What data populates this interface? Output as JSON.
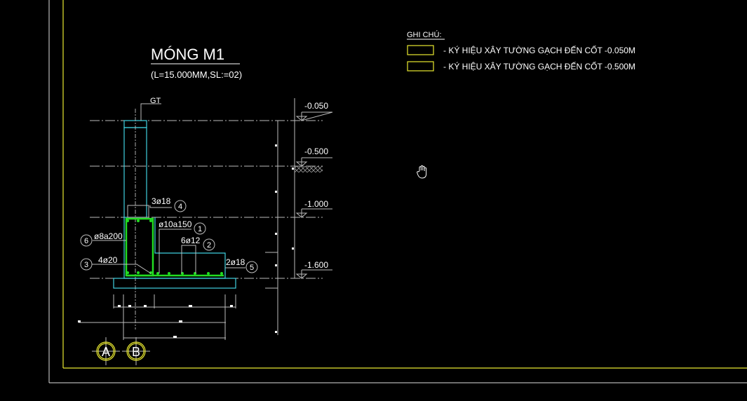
{
  "drawing": {
    "title": "MÓNG M1",
    "subtitle": "(L=15.000MM,SL:=02)",
    "wall_label": "GT",
    "levels": [
      "-0.050",
      "-0.500",
      "-1.000",
      "-1.600"
    ],
    "rebar_labels": [
      {
        "num": "4",
        "text": "3ø18"
      },
      {
        "num": "1",
        "text": "ø10a150"
      },
      {
        "num": "2",
        "text": "6ø12"
      },
      {
        "num": "6",
        "text": "ø8a200"
      },
      {
        "num": "3",
        "text": "4ø20"
      },
      {
        "num": "5",
        "text": "2ø18"
      }
    ],
    "axes": [
      "A",
      "B"
    ]
  },
  "legend": {
    "title": "GHI CHÚ:",
    "items": [
      {
        "text": "- KÝ HIỆU XÂY TƯỜNG GẠCH ĐẾN CỐT -0.050M",
        "pattern": "diagonal-hatch"
      },
      {
        "text": "- KÝ HIỆU XÂY TƯỜNG GẠCH ĐẾN CỐT -0.500M",
        "pattern": "cross-hatch"
      }
    ]
  },
  "colors": {
    "background": "#000000",
    "border_yellow": "#e8e830",
    "concrete_cyan": "#3fd0e0",
    "rebar_green": "#22dd22"
  }
}
